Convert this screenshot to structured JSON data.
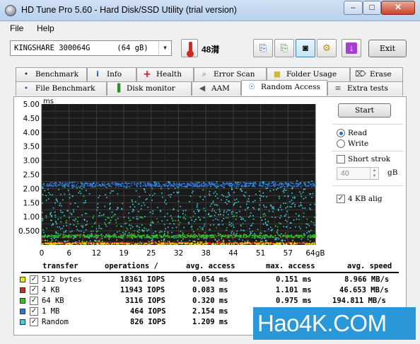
{
  "window": {
    "title": "HD Tune Pro 5.60 - Hard Disk/SSD Utility (trial version)",
    "minimize": "–",
    "maximize": "□",
    "close": "✕"
  },
  "menu": [
    {
      "label": "File"
    },
    {
      "label": "Help"
    }
  ],
  "toolbar": {
    "drive": "KINGSHARE 300064G      (64 gB)",
    "temperature": "48潸",
    "exit_label": "Exit"
  },
  "tabs_row1": [
    {
      "label": "Benchmark",
      "icon": "benchmark-icon",
      "glyph": "•"
    },
    {
      "label": "Info",
      "icon": "info-icon",
      "glyph": "i"
    },
    {
      "label": "Health",
      "icon": "health-icon",
      "glyph": "+"
    },
    {
      "label": "Error Scan",
      "icon": "error-scan-icon",
      "glyph": "⌕"
    },
    {
      "label": "Folder Usage",
      "icon": "folder-icon",
      "glyph": "■"
    },
    {
      "label": "Erase",
      "icon": "erase-icon",
      "glyph": "⌦"
    }
  ],
  "tabs_row2": [
    {
      "label": "File Benchmark",
      "icon": "file-benchmark-icon",
      "glyph": "•"
    },
    {
      "label": "Disk monitor",
      "icon": "disk-monitor-icon",
      "glyph": "▐"
    },
    {
      "label": "AAM",
      "icon": "speaker-icon",
      "glyph": "◀"
    },
    {
      "label": "Random Access",
      "icon": "random-access-icon",
      "glyph": "☉"
    },
    {
      "label": "Extra tests",
      "icon": "extra-tests-icon",
      "glyph": "≡"
    }
  ],
  "controls": {
    "start_label": "Start",
    "read_label": "Read",
    "write_label": "Write",
    "short_stroke_label": "Short strok",
    "short_stroke_value": "40",
    "gb_label": "gB",
    "align_label": "4 KB alig"
  },
  "table": {
    "headers": {
      "transfer": "transfer",
      "operations": "operations /",
      "avg_access": "avg. access",
      "max_access": "max. access",
      "avg_speed": "avg. speed"
    },
    "rows": [
      {
        "transfer": "512 bytes",
        "color": "#f0e800",
        "ops": "18361 IOPS",
        "avg": "0.054 ms",
        "max": "0.151 ms",
        "speed": "8.966 MB/s"
      },
      {
        "transfer": "4 KB",
        "color": "#d42a1a",
        "ops": "11943 IOPS",
        "avg": "0.083 ms",
        "max": "1.101 ms",
        "speed": "46.653 MB/s"
      },
      {
        "transfer": "64 KB",
        "color": "#2fc41f",
        "ops": "3116 IOPS",
        "avg": "0.320 ms",
        "max": "0.975 ms",
        "speed": "194.811 MB/s"
      },
      {
        "transfer": "1 MB",
        "color": "#2b78e0",
        "ops": "464 IOPS",
        "avg": "2.154 ms",
        "max": "",
        "speed": ""
      },
      {
        "transfer": "Random",
        "color": "#38d6e8",
        "ops": "826 IOPS",
        "avg": "1.209 ms",
        "max": "",
        "speed": ""
      }
    ]
  },
  "watermark": "Hao4K.COM",
  "chart_data": {
    "type": "scatter",
    "ylabel": "ms",
    "y_ticks": [
      "5.00",
      "4.50",
      "4.00",
      "3.50",
      "3.00",
      "2.50",
      "2.00",
      "1.50",
      "1.00",
      "0.500"
    ],
    "x_ticks": [
      "0",
      "6",
      "12",
      "19",
      "25",
      "32",
      "38",
      "44",
      "51",
      "57",
      "64gB"
    ],
    "xlim": [
      0,
      64
    ],
    "ylim": [
      0,
      5
    ],
    "grid": true,
    "series": [
      {
        "name": "512 bytes",
        "color": "#f0e800",
        "band": [
          0.03,
          0.09
        ],
        "spread": 0.15
      },
      {
        "name": "4 KB",
        "color": "#d42a1a",
        "band": [
          0.05,
          0.12
        ],
        "spread": 0.4
      },
      {
        "name": "64 KB",
        "color": "#2fc41f",
        "band": [
          0.28,
          0.38
        ],
        "spread": 0.9
      },
      {
        "name": "1 MB",
        "color": "#2b78e0",
        "band": [
          2.08,
          2.24
        ],
        "spread": 0.1
      },
      {
        "name": "Random",
        "color": "#38d6e8",
        "band": [
          0.05,
          2.3
        ],
        "spread": 0.0
      }
    ]
  }
}
